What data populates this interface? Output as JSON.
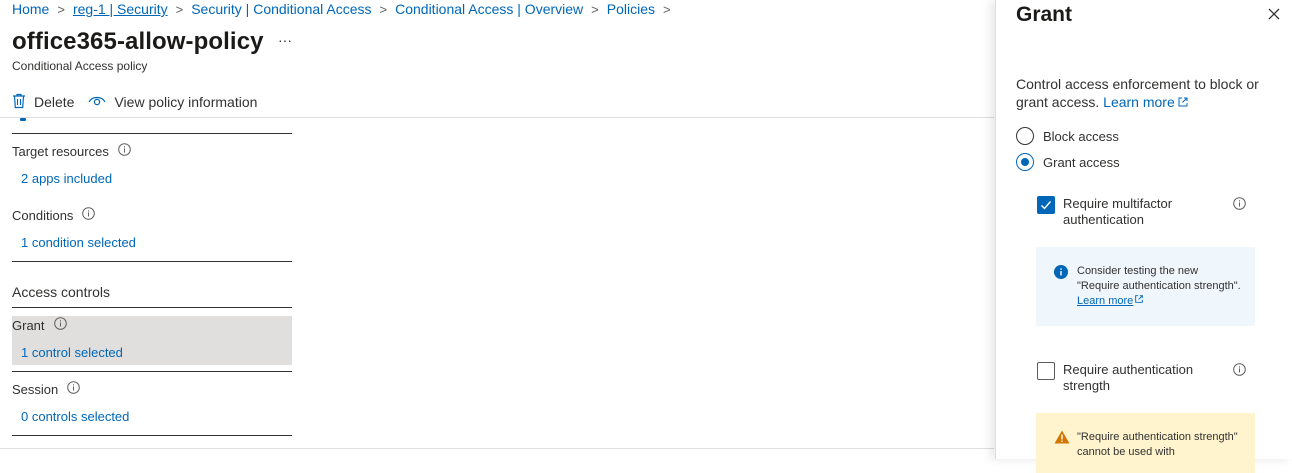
{
  "breadcrumb": [
    {
      "label": "Home"
    },
    {
      "label": "reg-1 | Security"
    },
    {
      "label": "Security | Conditional Access"
    },
    {
      "label": "Conditional Access | Overview"
    },
    {
      "label": "Policies"
    }
  ],
  "breadcrumb_sep": ">",
  "page": {
    "title": "office365-allow-policy",
    "more": "···",
    "subtitle": "Conditional Access policy"
  },
  "toolbar": {
    "delete_label": "Delete",
    "view_policy_label": "View policy information"
  },
  "sections": {
    "target_resources": {
      "title": "Target resources",
      "link": "2 apps included"
    },
    "conditions": {
      "title": "Conditions",
      "link": "1 condition selected"
    },
    "access_controls": "Access controls",
    "grant": {
      "title": "Grant",
      "link": "1 control selected"
    },
    "session": {
      "title": "Session",
      "link": "0 controls selected"
    }
  },
  "panel": {
    "title": "Grant",
    "description": "Control access enforcement to block or grant access.",
    "learn_more": "Learn more",
    "block_access": "Block access",
    "grant_access": "Grant access",
    "require_mfa": "Require multifactor authentication",
    "require_mfa_checked": true,
    "info_text": "Consider testing the new \"Require authentication strength\".",
    "info_learn_more": "Learn more",
    "require_auth_strength": "Require authentication strength",
    "require_auth_strength_checked": false,
    "warning_text": "\"Require authentication strength\" cannot be used with"
  },
  "colors": {
    "link": "#0067b8",
    "selected_section": "#e1dfdd",
    "info_background": "#eff6fc",
    "warning_background": "#fff4ce",
    "warning_icon": "#d47500"
  },
  "icons": [
    "trash-icon",
    "eye-icon",
    "info-icon",
    "close-icon",
    "external-link-icon",
    "warning-icon",
    "checkmark-icon"
  ]
}
